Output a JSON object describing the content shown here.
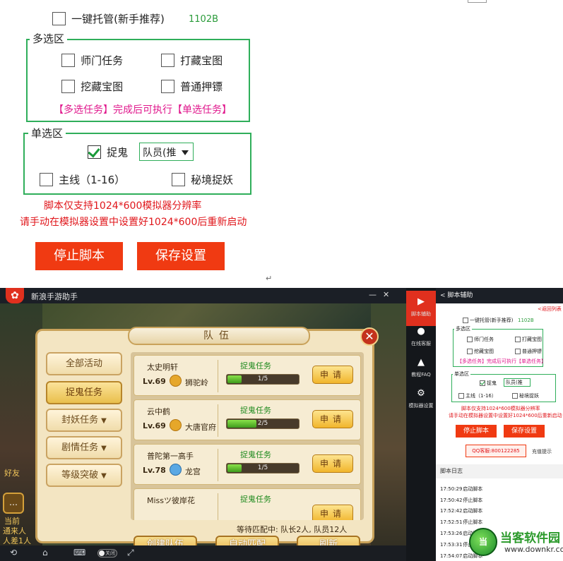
{
  "settings": {
    "auto_host": {
      "label": "一键托管(新手推荐)",
      "checked": false
    },
    "version": "1102B",
    "multi_group": {
      "title": "多选区",
      "options": [
        {
          "label": "师门任务",
          "checked": false
        },
        {
          "label": "打藏宝图",
          "checked": false
        },
        {
          "label": "挖藏宝图",
          "checked": false
        },
        {
          "label": "普通押镖",
          "checked": false
        }
      ],
      "note": "【多选任务】完成后可执行【单选任务】"
    },
    "single_group": {
      "title": "单选区",
      "ghost": {
        "label": "捉鬼",
        "checked": true
      },
      "role_select": "队员(推",
      "mainline": {
        "label": "主线（1-16）",
        "checked": false
      },
      "secret": {
        "label": "秘境捉妖",
        "checked": false
      }
    },
    "warning_1": "脚本仅支持1024*600模拟器分辨率",
    "warning_2": "请手动在模拟器设置中设置好1024*600后重新启动",
    "stop_button": "停止脚本",
    "save_button": "保存设置",
    "para_mark": "↵"
  },
  "emulator": {
    "title": "新浪手游助手",
    "controls": [
      "—",
      "✕"
    ],
    "logo": "✿",
    "panel_title": "队伍",
    "close": "✕",
    "tabs": [
      {
        "label": "全部活动",
        "chevron": false,
        "active": false
      },
      {
        "label": "捉鬼任务",
        "chevron": false,
        "active": true
      },
      {
        "label": "封妖任务",
        "chevron": true,
        "active": false
      },
      {
        "label": "剧情任务",
        "chevron": true,
        "active": false
      },
      {
        "label": "等级突破",
        "chevron": true,
        "active": false
      }
    ],
    "teams": [
      {
        "name": "太史明轩",
        "level": "Lv.69",
        "sect": "狮驼岭",
        "task": "捉鬼任务",
        "progress_text": "1/5",
        "progress": 0.2,
        "apply": "申请",
        "icon_color": "orange"
      },
      {
        "name": "云中鹤",
        "level": "Lv.69",
        "sect": "大唐官府",
        "task": "捉鬼任务",
        "progress_text": "2/5",
        "progress": 0.4,
        "apply": "申请",
        "icon_color": "orange"
      },
      {
        "name": "普陀第一高手",
        "level": "Lv.78",
        "sect": "龙宫",
        "task": "捉鬼任务",
        "progress_text": "1/5",
        "progress": 0.2,
        "apply": "申请",
        "icon_color": "blue"
      },
      {
        "name": "Missツ彼岸花",
        "level": "",
        "sect": "",
        "task": "捉鬼任务",
        "progress_text": "",
        "progress": 0,
        "apply": "申请",
        "icon_color": "none"
      }
    ],
    "waiting": "等待匹配中: 队长2人, 队员12人",
    "buttons": {
      "create": "创建队伍",
      "auto": "自动匹配",
      "refresh": "刷新"
    },
    "side_texts": [
      "好友",
      "当前",
      "通来人",
      "人差1人"
    ],
    "chat_icon": "…",
    "nav": {
      "back": "⟲",
      "home": "⌂",
      "keyboard": "⌨",
      "toggle": "关闭",
      "fullscreen": "⤢"
    }
  },
  "sidenav": [
    {
      "label": "脚本辅助",
      "icon": "▶",
      "active": true
    },
    {
      "label": "在线客服",
      "icon": "●",
      "active": false
    },
    {
      "label": "教程FAQ",
      "icon": "▲",
      "active": false
    },
    {
      "label": "模拟器设置",
      "icon": "⚙",
      "active": false
    }
  ],
  "helper": {
    "header": "< 脚本辅助",
    "back": "<返回列表",
    "auto_host": "一键托管(新手推荐)",
    "version": "1102B",
    "multi_title": "多选区",
    "options": [
      "师门任务",
      "打藏宝图",
      "挖藏宝图",
      "普通押镖"
    ],
    "note": "【多选任务】完成后可执行【单选任务】",
    "single_title": "单选区",
    "ghost": "捉鬼",
    "role_select": "队员(推",
    "mainline": "主线（1-16）",
    "secret": "秘境捉妖",
    "warning_1": "脚本仅支持1024*600模拟器分辨率",
    "warning_2": "请手动在模拟器设置中设置好1024*600后重新启动",
    "stop_button": "停止脚本",
    "save_button": "保存设置",
    "qq": "QQ客服:800122285",
    "recharge": "充值提示",
    "log_title": "脚本日志",
    "logs": [
      {
        "time": "17:50:29",
        "msg": "启动脚本"
      },
      {
        "time": "17:50:42",
        "msg": "停止脚本"
      },
      {
        "time": "17:52:42",
        "msg": "启动脚本"
      },
      {
        "time": "17:52:51",
        "msg": "停止脚本"
      },
      {
        "time": "17:53:26",
        "msg": "启动脚本"
      },
      {
        "time": "17:53:31",
        "msg": "停止脚本"
      },
      {
        "time": "17:54:07",
        "msg": "启动脚本"
      }
    ]
  },
  "watermark": {
    "name": "当客软件园",
    "url": "www.downkr.com",
    "badge": "当"
  }
}
